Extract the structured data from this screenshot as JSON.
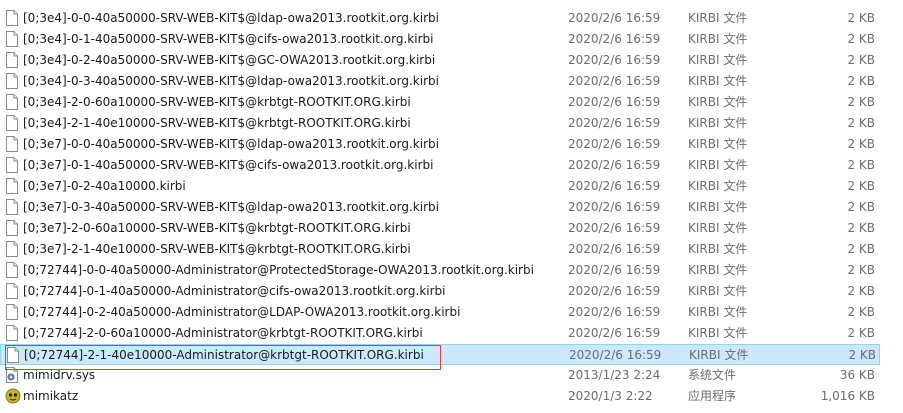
{
  "files": [
    {
      "name": "[0;3e4]-0-0-40a50000-SRV-WEB-KIT$@ldap-owa2013.rootkit.org.kirbi",
      "date": "2020/2/6 16:59",
      "type": "KIRBI 文件",
      "size": "2 KB",
      "icon": "file-icon",
      "selected": false
    },
    {
      "name": "[0;3e4]-0-1-40a50000-SRV-WEB-KIT$@cifs-owa2013.rootkit.org.kirbi",
      "date": "2020/2/6 16:59",
      "type": "KIRBI 文件",
      "size": "2 KB",
      "icon": "file-icon",
      "selected": false
    },
    {
      "name": "[0;3e4]-0-2-40a50000-SRV-WEB-KIT$@GC-OWA2013.rootkit.org.kirbi",
      "date": "2020/2/6 16:59",
      "type": "KIRBI 文件",
      "size": "2 KB",
      "icon": "file-icon",
      "selected": false
    },
    {
      "name": "[0;3e4]-0-3-40a50000-SRV-WEB-KIT$@ldap-owa2013.rootkit.org.kirbi",
      "date": "2020/2/6 16:59",
      "type": "KIRBI 文件",
      "size": "2 KB",
      "icon": "file-icon",
      "selected": false
    },
    {
      "name": "[0;3e4]-2-0-60a10000-SRV-WEB-KIT$@krbtgt-ROOTKIT.ORG.kirbi",
      "date": "2020/2/6 16:59",
      "type": "KIRBI 文件",
      "size": "2 KB",
      "icon": "file-icon",
      "selected": false
    },
    {
      "name": "[0;3e4]-2-1-40e10000-SRV-WEB-KIT$@krbtgt-ROOTKIT.ORG.kirbi",
      "date": "2020/2/6 16:59",
      "type": "KIRBI 文件",
      "size": "2 KB",
      "icon": "file-icon",
      "selected": false
    },
    {
      "name": "[0;3e7]-0-0-40a50000-SRV-WEB-KIT$@ldap-owa2013.rootkit.org.kirbi",
      "date": "2020/2/6 16:59",
      "type": "KIRBI 文件",
      "size": "2 KB",
      "icon": "file-icon",
      "selected": false
    },
    {
      "name": "[0;3e7]-0-1-40a50000-SRV-WEB-KIT$@cifs-owa2013.rootkit.org.kirbi",
      "date": "2020/2/6 16:59",
      "type": "KIRBI 文件",
      "size": "2 KB",
      "icon": "file-icon",
      "selected": false
    },
    {
      "name": "[0;3e7]-0-2-40a10000.kirbi",
      "date": "2020/2/6 16:59",
      "type": "KIRBI 文件",
      "size": "2 KB",
      "icon": "file-icon",
      "selected": false
    },
    {
      "name": "[0;3e7]-0-3-40a50000-SRV-WEB-KIT$@ldap-owa2013.rootkit.org.kirbi",
      "date": "2020/2/6 16:59",
      "type": "KIRBI 文件",
      "size": "2 KB",
      "icon": "file-icon",
      "selected": false
    },
    {
      "name": "[0;3e7]-2-0-60a10000-SRV-WEB-KIT$@krbtgt-ROOTKIT.ORG.kirbi",
      "date": "2020/2/6 16:59",
      "type": "KIRBI 文件",
      "size": "2 KB",
      "icon": "file-icon",
      "selected": false
    },
    {
      "name": "[0;3e7]-2-1-40e10000-SRV-WEB-KIT$@krbtgt-ROOTKIT.ORG.kirbi",
      "date": "2020/2/6 16:59",
      "type": "KIRBI 文件",
      "size": "2 KB",
      "icon": "file-icon",
      "selected": false
    },
    {
      "name": "[0;72744]-0-0-40a50000-Administrator@ProtectedStorage-OWA2013.rootkit.org.kirbi",
      "date": "2020/2/6 16:59",
      "type": "KIRBI 文件",
      "size": "2 KB",
      "icon": "file-icon",
      "selected": false
    },
    {
      "name": "[0;72744]-0-1-40a50000-Administrator@cifs-owa2013.rootkit.org.kirbi",
      "date": "2020/2/6 16:59",
      "type": "KIRBI 文件",
      "size": "2 KB",
      "icon": "file-icon",
      "selected": false
    },
    {
      "name": "[0;72744]-0-2-40a50000-Administrator@LDAP-OWA2013.rootkit.org.kirbi",
      "date": "2020/2/6 16:59",
      "type": "KIRBI 文件",
      "size": "2 KB",
      "icon": "file-icon",
      "selected": false
    },
    {
      "name": "[0;72744]-2-0-60a10000-Administrator@krbtgt-ROOTKIT.ORG.kirbi",
      "date": "2020/2/6 16:59",
      "type": "KIRBI 文件",
      "size": "2 KB",
      "icon": "file-icon",
      "selected": false
    },
    {
      "name": "[0;72744]-2-1-40e10000-Administrator@krbtgt-ROOTKIT.ORG.kirbi",
      "date": "2020/2/6 16:59",
      "type": "KIRBI 文件",
      "size": "2 KB",
      "icon": "file-icon",
      "selected": true
    },
    {
      "name": "mimidrv.sys",
      "date": "2013/1/23 2:24",
      "type": "系统文件",
      "size": "36 KB",
      "icon": "system-file-icon",
      "selected": false
    },
    {
      "name": "mimikatz",
      "date": "2020/1/3 2:22",
      "type": "应用程序",
      "size": "1,016 KB",
      "icon": "mimikatz-app-icon",
      "selected": false
    }
  ],
  "colors": {
    "selection_bg": "#cce8ff",
    "selection_border": "#99d1ff",
    "highlight_box": "#e0393e",
    "secondary_text": "#6d6d6d"
  }
}
